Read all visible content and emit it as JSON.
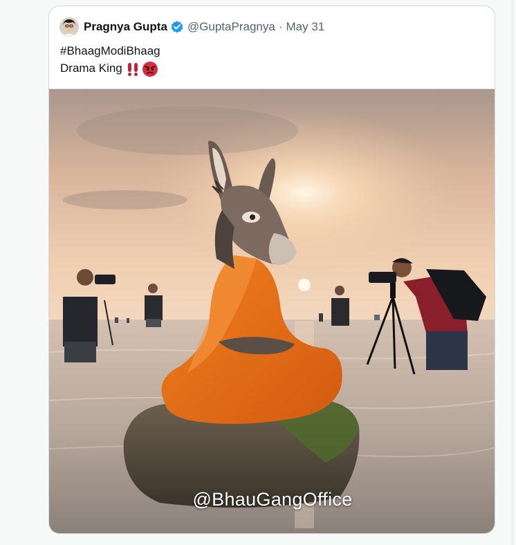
{
  "tweet": {
    "author_name": "Pragnya Gupta",
    "handle": "@GuptaPragnya",
    "separator": "·",
    "date": "May 31",
    "lines": [
      "#BhaagModiBhaag",
      "Drama King"
    ],
    "emojis": [
      "double-exclamation",
      "angry-face"
    ]
  },
  "media": {
    "watermark": "@BhauGangOffice"
  },
  "colors": {
    "text": "#0f1419",
    "secondary": "#536471",
    "verified": "#1d9bf0",
    "robe": "#e8701a",
    "border": "#cfd9de"
  }
}
